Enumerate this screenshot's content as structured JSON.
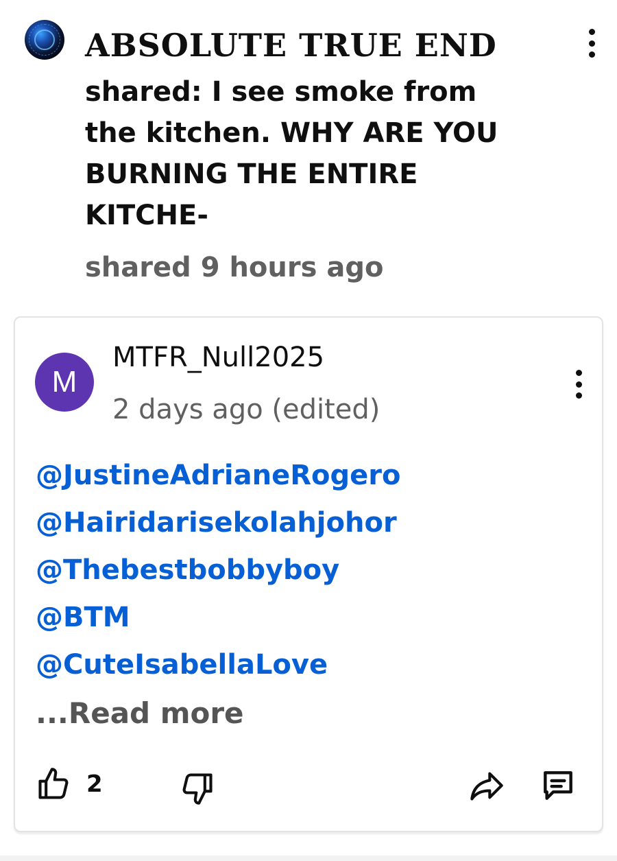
{
  "post": {
    "author": "ABSOLUTE TRUE END",
    "text": "shared: I see smoke from the kitchen. WHY ARE YOU BURNING THE ENTIRE KITCHE-",
    "time": "shared 9 hours ago",
    "menu_icon": "more-vertical-icon"
  },
  "comment": {
    "avatar_letter": "M",
    "avatar_color": "#5e35b1",
    "author": "MTFR_Null2025",
    "time": "2 days ago (edited)",
    "mentions": [
      "@JustineAdrianeRogero",
      "@Hairidarisekolahjohor",
      "@Thebestbobbyboy",
      "@BTM",
      "@CuteIsabellaLove"
    ],
    "read_more": "...Read more",
    "like_count": "2",
    "menu_icon": "more-vertical-icon",
    "mention_color": "#065fd4"
  }
}
